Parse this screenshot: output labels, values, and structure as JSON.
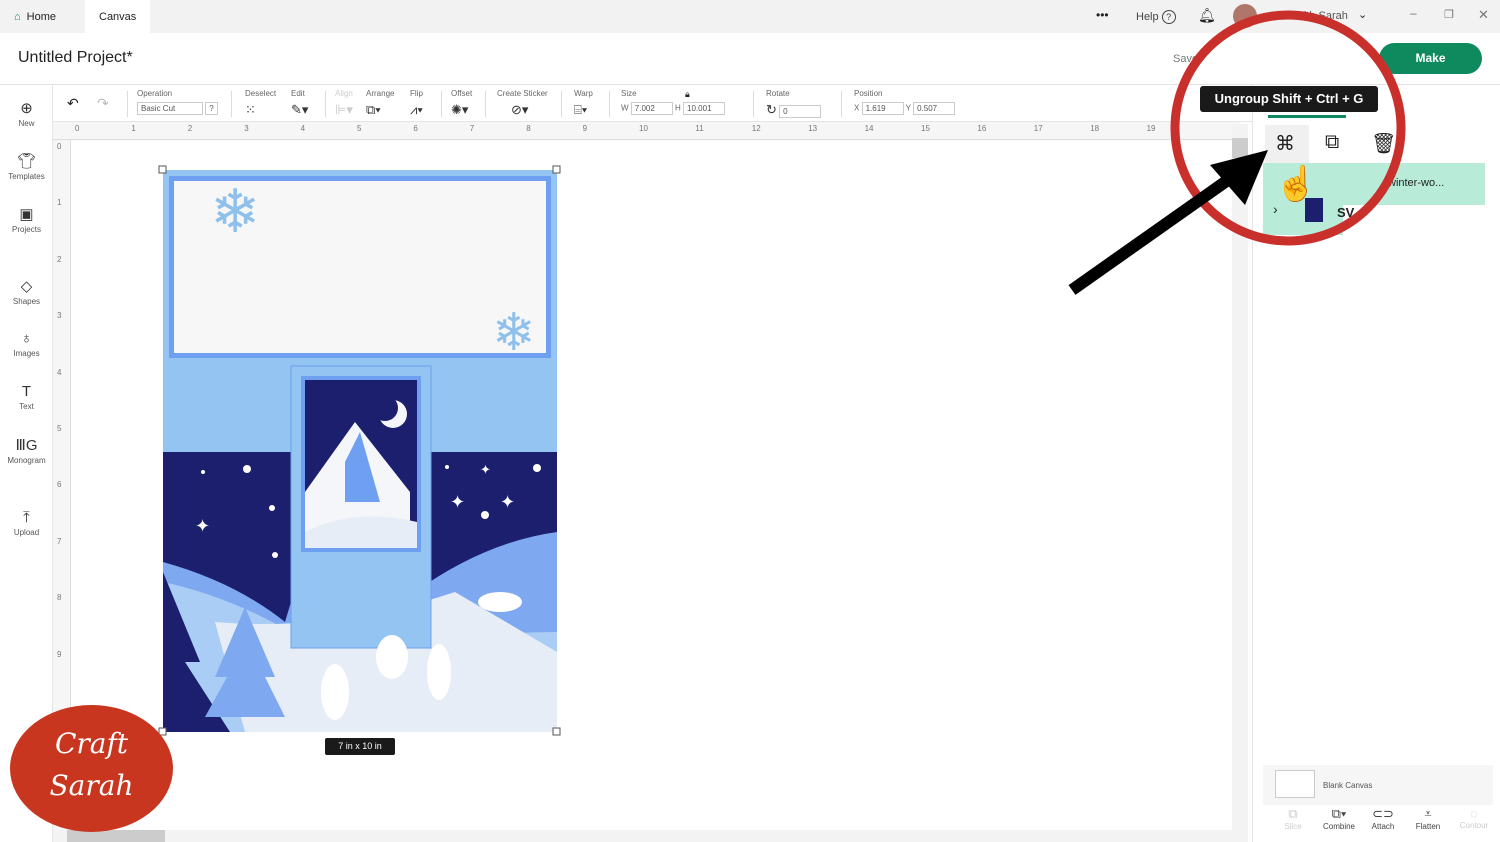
{
  "tabs": {
    "home": "Home",
    "canvas": "Canvas"
  },
  "topbar": {
    "more": "•••",
    "help": "Help",
    "user": "Craft with Sarah"
  },
  "project": {
    "title": "Untitled Project*",
    "save": "Save",
    "make": "Make"
  },
  "toolbar": {
    "operation_label": "Operation",
    "operation_value": "Basic Cut",
    "operation_help": "?",
    "deselect": "Deselect",
    "edit": "Edit",
    "align": "Align",
    "arrange": "Arrange",
    "flip": "Flip",
    "offset": "Offset",
    "create_sticker": "Create Sticker",
    "warp": "Warp",
    "size": "Size",
    "w_label": "W",
    "w_value": "7.002",
    "h_label": "H",
    "h_value": "10.001",
    "rotate": "Rotate",
    "rotate_value": "0",
    "position": "Position",
    "x_label": "X",
    "x_value": "1.619",
    "y_label": "Y",
    "y_value": "0.507"
  },
  "sidebar": [
    "New",
    "Templates",
    "Projects",
    "Shapes",
    "Images",
    "Text",
    "Monogram",
    "Upload"
  ],
  "ruler_h": [
    "0",
    "1",
    "2",
    "3",
    "4",
    "5",
    "6",
    "7",
    "8",
    "9",
    "10",
    "11",
    "12",
    "13",
    "14",
    "15",
    "16",
    "17",
    "18",
    "19"
  ],
  "ruler_v": [
    "0",
    "1",
    "2",
    "3",
    "4",
    "5",
    "6",
    "7",
    "8",
    "9"
  ],
  "canvas": {
    "size_label": "7 in x 10 in"
  },
  "tooltip": "Ungroup Shift + Ctrl + G",
  "layers": {
    "group_name": "winter-wo...",
    "item_name": "SV",
    "blank_canvas": "Blank Canvas"
  },
  "bottom_actions": [
    "Slice",
    "Combine",
    "Attach",
    "Flatten",
    "Contour"
  ],
  "watermark": "Craft with Sarah",
  "colors": {
    "accent": "#0f8a5f",
    "highlight": "#c9302c",
    "layer": "#b8ecd9"
  }
}
